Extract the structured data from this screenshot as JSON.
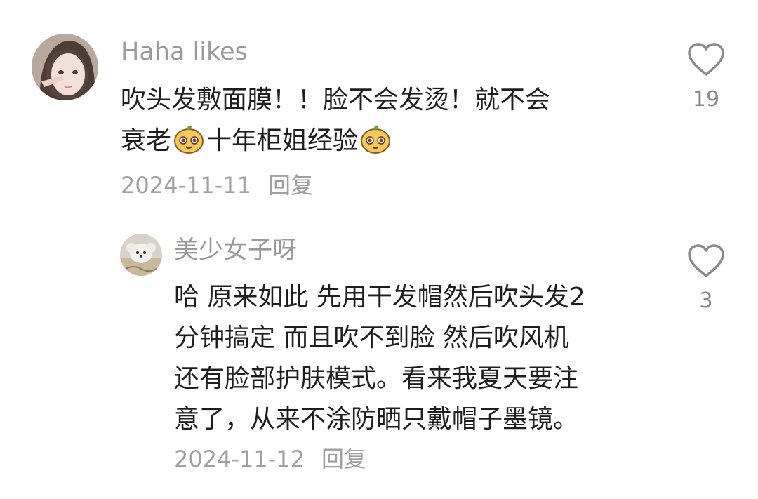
{
  "comments": [
    {
      "username": "Haha likes",
      "text_line1": "吹头发敷面膜！！脸不会发烫！就不会",
      "text_line2a": "衰老",
      "text_line2b": "十年柜姐经验",
      "date": "2024-11-11",
      "reply_label": "回复",
      "like_count": "19",
      "emoji": "smiling-fruit-emoji"
    },
    {
      "username": "美少女子呀",
      "text_lines": [
        "哈 原来如此 先用干发帽然后吹头发2",
        "分钟搞定 而且吹不到脸 然后吹风机",
        "还有脸部护肤模式。看来我夏天要注",
        "意了，从来不涂防晒只戴帽子墨镜。"
      ],
      "date": "2024-11-12",
      "reply_label": "回复",
      "like_count": "3"
    }
  ],
  "icons": {
    "like": "heart-outline-icon"
  },
  "colors": {
    "text": "#1e1e1e",
    "secondary": "#9a9a9a",
    "icon": "#8a8a8a"
  }
}
